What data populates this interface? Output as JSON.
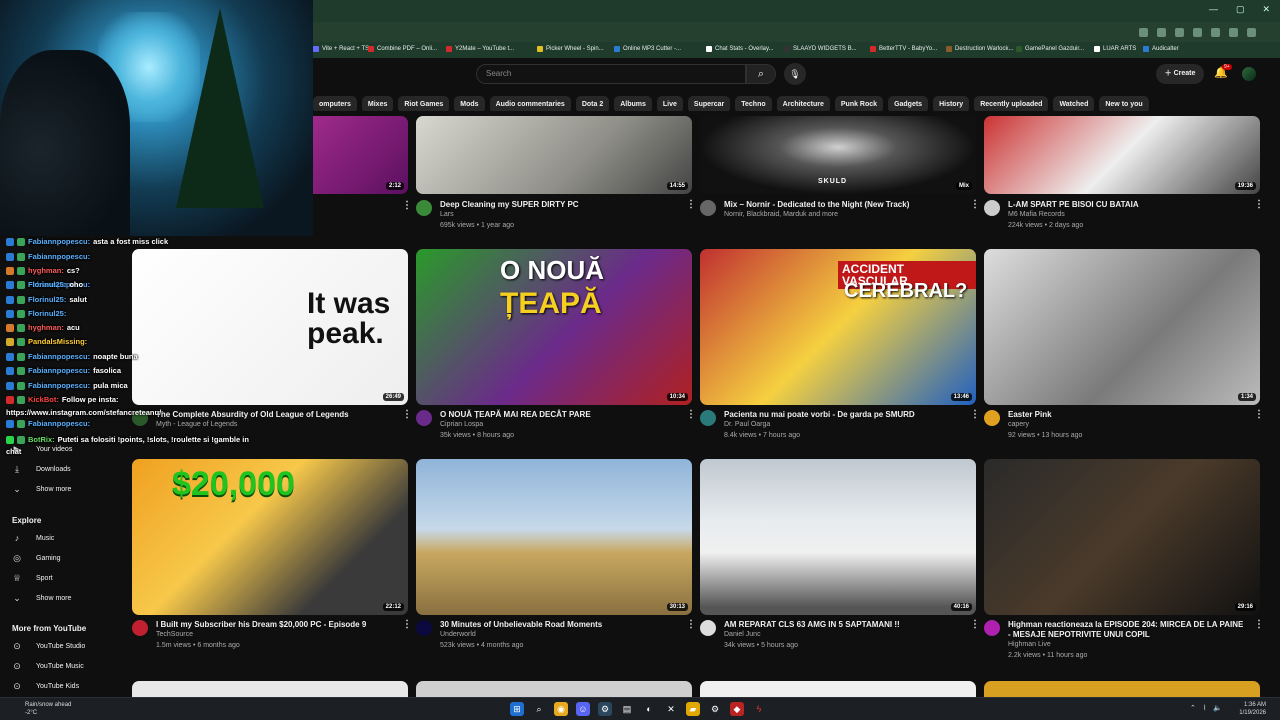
{
  "search": {
    "placeholder": "Search"
  },
  "header": {
    "create_label": "Create",
    "notif_count": "9+"
  },
  "bookmarks": [
    {
      "label": "Vite + React + TS",
      "color": "#646cff"
    },
    {
      "label": "Combine PDF – Onli...",
      "color": "#d42a2a"
    },
    {
      "label": "Y2Mate – YouTube t...",
      "color": "#d42a2a"
    },
    {
      "label": "Picker Wheel - Spin...",
      "color": "#e0c020"
    },
    {
      "label": "Online MP3 Cutter -...",
      "color": "#2a7bd4"
    },
    {
      "label": "Chat Stats - Overlay...",
      "color": "#ffffff"
    },
    {
      "label": "SLAAYD WIDGETS B...",
      "color": "#333333"
    },
    {
      "label": "BetterTTV - BabyYo...",
      "color": "#d42a2a"
    },
    {
      "label": "Destruction Warlock...",
      "color": "#8a5a2a"
    },
    {
      "label": "GamePanel Gazduir...",
      "color": "#2a5a2a"
    },
    {
      "label": "LUAR ARTS",
      "color": "#ffffff"
    },
    {
      "label": "Audicalter",
      "color": "#2a7bd4"
    }
  ],
  "chips": [
    "omputers",
    "Mixes",
    "Riot Games",
    "Mods",
    "Audio commentaries",
    "Dota 2",
    "Albums",
    "Live",
    "Supercar",
    "Techno",
    "Architecture",
    "Punk Rock",
    "Gadgets",
    "History",
    "Recently uploaded",
    "Watched",
    "New to you"
  ],
  "sidebar": {
    "items_top": [
      {
        "label": "Your videos",
        "icon": "your-videos-icon",
        "glyph": "▶"
      },
      {
        "label": "Downloads",
        "icon": "download-icon",
        "glyph": "⤓"
      },
      {
        "label": "Show more",
        "icon": "chevron-down-icon",
        "glyph": "⌄"
      }
    ],
    "explore_heading": "Explore",
    "explore": [
      {
        "label": "Music",
        "icon": "music-icon",
        "glyph": "♪"
      },
      {
        "label": "Gaming",
        "icon": "gaming-icon",
        "glyph": "◎"
      },
      {
        "label": "Sport",
        "icon": "trophy-icon",
        "glyph": "♕"
      },
      {
        "label": "Show more",
        "icon": "chevron-down-icon",
        "glyph": "⌄"
      }
    ],
    "more_heading": "More from YouTube",
    "more": [
      {
        "label": "YouTube Studio",
        "icon": "youtube-studio-icon",
        "glyph": "⊙"
      },
      {
        "label": "YouTube Music",
        "icon": "youtube-music-icon",
        "glyph": "⊙"
      },
      {
        "label": "YouTube Kids",
        "icon": "youtube-kids-icon",
        "glyph": "⊙"
      }
    ]
  },
  "chat": [
    {
      "user": "Fabiannpopescu:",
      "msg": "asta a fost miss click",
      "color": "#5ab0ff"
    },
    {
      "user": "Fabiannpopescu:",
      "msg": "",
      "color": "#5ab0ff"
    },
    {
      "user": "hyghman:",
      "msg": "cs?",
      "color": "#ff5a5a"
    },
    {
      "user": "Fabiannpopescu:",
      "msg": "",
      "color": "#5ab0ff"
    },
    {
      "user": "Florinul25:",
      "msg": "oho",
      "color": "#5ab0ff"
    },
    {
      "user": "Florinul25:",
      "msg": "salut",
      "color": "#5ab0ff"
    },
    {
      "user": "Florinul25:",
      "msg": "",
      "color": "#5ab0ff"
    },
    {
      "user": "hyghman:",
      "msg": "acu",
      "color": "#ff5a5a"
    },
    {
      "user": "PandalsMissing:",
      "msg": "",
      "color": "#ffcc33"
    },
    {
      "user": "Fabiannpopescu:",
      "msg": "noapte buna",
      "color": "#5ab0ff"
    },
    {
      "user": "Fabiannpopescu:",
      "msg": "fasolica",
      "color": "#5ab0ff"
    },
    {
      "user": "Fabiannpopescu:",
      "msg": "pula mica",
      "color": "#5ab0ff"
    },
    {
      "user": "KickBot:",
      "msg": "Follow pe insta:",
      "color": "#ff4444"
    },
    {
      "user": "",
      "msg": "https://www.instagram.com/stefancreteanu/",
      "color": "#ffffff"
    },
    {
      "user": "Fabiannpopescu:",
      "msg": "",
      "color": "#5ab0ff"
    },
    {
      "user": "BotRix:",
      "msg": "Puteti sa folositi !points, !slots, !roulette si !gamble in",
      "color": "#66dd66"
    },
    {
      "user": "",
      "msg": "chat",
      "color": "#ffffff"
    }
  ],
  "videos_row0": [
    {
      "title": "",
      "channel": "",
      "meta": "",
      "duration": "2:12"
    },
    {
      "title": "Deep Cleaning my SUPER DIRTY PC",
      "channel": "Lars",
      "meta": "695k views • 1 year ago",
      "duration": "14:55"
    },
    {
      "title": "Mix – Nornir - Dedicated to the Night (New Track)",
      "channel": "Nornir, Blackbraid, Marduk and more",
      "meta": "",
      "duration": "Mix",
      "thumb_text": "SKULD"
    },
    {
      "title": "L-AM SPART PE BISOI CU BATAIA",
      "channel": "M6 Mafia Records",
      "meta": "224k views • 2 days ago",
      "duration": "19:36"
    }
  ],
  "videos_row1": [
    {
      "title": "The Complete Absurdity of Old League of Legends",
      "channel": "Myth - League of Legends",
      "meta": "",
      "duration": "26:49",
      "thumb_text": "It was peak."
    },
    {
      "title": "O NOUĂ ȚEAPĂ MAI REA DECÂT PARE",
      "channel": "Ciprian Lospa",
      "meta": "35k views • 8 hours ago",
      "duration": "10:34",
      "thumb_text_1": "O NOUĂ",
      "thumb_text_2": "ȚEAPĂ"
    },
    {
      "title": "Pacienta nu mai poate vorbi - De garda pe SMURD",
      "channel": "Dr. Paul Oarga",
      "meta": "8.4k views • 7 hours ago",
      "duration": "13:46",
      "thumb_text_1": "ACCIDENT VASCULAR",
      "thumb_text_2": "CEREBRAL?"
    },
    {
      "title": "Easter Pink",
      "channel": "capery",
      "meta": "92 views • 13 hours ago",
      "duration": "1:34"
    }
  ],
  "videos_row2": [
    {
      "title": "I Built my Subscriber his Dream $20,000 PC - Episode 9",
      "channel": "TechSource",
      "meta": "1.5m views • 6 months ago",
      "duration": "22:12",
      "thumb_text": "$20,000"
    },
    {
      "title": "30 Minutes of Unbelievable Road Moments",
      "channel": "Underworld",
      "meta": "523k views • 4 months ago",
      "duration": "30:13"
    },
    {
      "title": "AM REPARAT CLS 63 AMG IN 5 SAPTAMANI !!",
      "channel": "Daniel Junc",
      "meta": "34k views • 5 hours ago",
      "duration": "40:16"
    },
    {
      "title": "Highman reactioneaza la EPISODE 204: MIRCEA DE LA PAINE - MESAJE NEPOTRIVITE UNUI COPIL",
      "channel": "Highman Live",
      "meta": "2.2k views • 11 hours ago",
      "duration": "29:16"
    }
  ],
  "taskbar": {
    "weather_line1": "Rain/snow ahead",
    "weather_line2": "-2°C",
    "time": "1:36 AM",
    "date": "1/19/2026"
  }
}
